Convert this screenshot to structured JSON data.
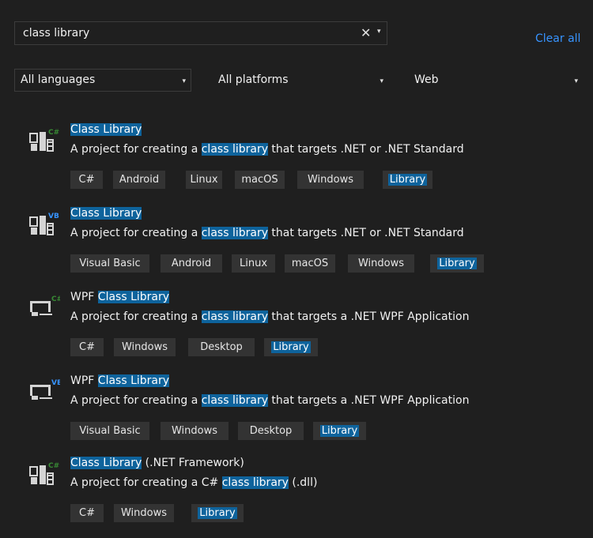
{
  "search": {
    "value": "class library",
    "clear_glyph": "✕",
    "dropdown_glyph": "▾"
  },
  "clear_all_label": "Clear all",
  "filters": [
    {
      "label": "All languages",
      "arrow": "▾"
    },
    {
      "label": "All platforms",
      "arrow": "▾"
    },
    {
      "label": "Web",
      "arrow": "▾"
    }
  ],
  "colors": {
    "highlight": "#0e639c",
    "csharp": "#388a34",
    "vb": "#3794ff"
  },
  "templates": [
    {
      "icon": "class-library-csharp-icon",
      "badge": "C#",
      "title_pre": "",
      "title_hl": "Class Library",
      "title_post": "",
      "desc_pre": "A project for creating a ",
      "desc_hl": "class library",
      "desc_post": " that targets .NET or .NET Standard",
      "tags": [
        "C#",
        "Android",
        "Linux",
        "macOS",
        "Windows",
        "Library"
      ]
    },
    {
      "icon": "class-library-vb-icon",
      "badge": "VB",
      "title_pre": "",
      "title_hl": "Class Library",
      "title_post": "",
      "desc_pre": "A project for creating a ",
      "desc_hl": "class library",
      "desc_post": " that targets .NET or .NET Standard",
      "tags": [
        "Visual Basic",
        "Android",
        "Linux",
        "macOS",
        "Windows",
        "Library"
      ]
    },
    {
      "icon": "wpf-class-library-csharp-icon",
      "badge": "C#",
      "title_pre": "WPF ",
      "title_hl": "Class Library",
      "title_post": "",
      "desc_pre": "A project for creating a ",
      "desc_hl": "class library",
      "desc_post": " that targets a .NET WPF Application",
      "tags": [
        "C#",
        "Windows",
        "Desktop",
        "Library"
      ]
    },
    {
      "icon": "wpf-class-library-vb-icon",
      "badge": "VB",
      "title_pre": "WPF ",
      "title_hl": "Class Library",
      "title_post": "",
      "desc_pre": "A project for creating a ",
      "desc_hl": "class library",
      "desc_post": " that targets a .NET WPF Application",
      "tags": [
        "Visual Basic",
        "Windows",
        "Desktop",
        "Library"
      ]
    },
    {
      "icon": "class-library-netfx-csharp-icon",
      "badge": "C#",
      "title_pre": "",
      "title_hl": "Class Library",
      "title_post": " (.NET Framework)",
      "desc_pre": "A project for creating a C# ",
      "desc_hl": "class library",
      "desc_post": " (.dll)",
      "tags": [
        "C#",
        "Windows",
        "Library"
      ]
    }
  ]
}
